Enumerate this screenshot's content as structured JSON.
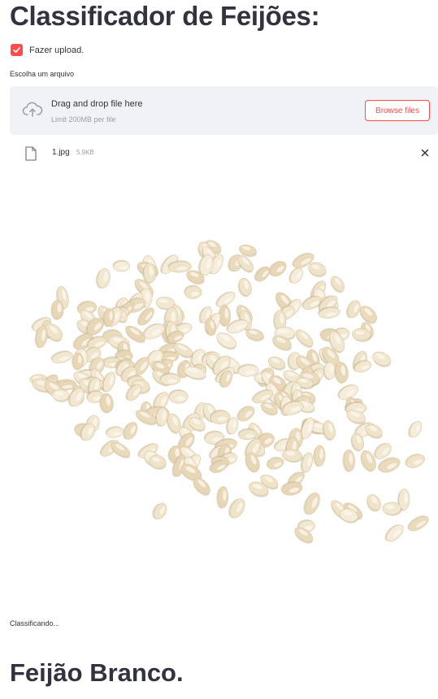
{
  "page": {
    "title": "Classificador de Feijões:",
    "status_text": "Classificando...",
    "result_text": "Feijão Branco."
  },
  "upload_toggle": {
    "label": "Fazer upload.",
    "checked": true
  },
  "uploader": {
    "label": "Escolha um arquivo",
    "drop_title": "Drag and drop file here",
    "limit_text": "Limit 200MB per file",
    "browse_label": "Browse files"
  },
  "uploaded_file": {
    "name": "1.jpg",
    "size": "5.9KB"
  },
  "icons": [
    "check-icon",
    "cloud-upload-icon",
    "file-icon",
    "close-icon"
  ],
  "colors": {
    "accent": "#ff4b4b",
    "text": "#31333f",
    "dropzone_bg": "#f0f2f6",
    "muted": "#9aa0a8",
    "bean": "#efe3c9"
  }
}
